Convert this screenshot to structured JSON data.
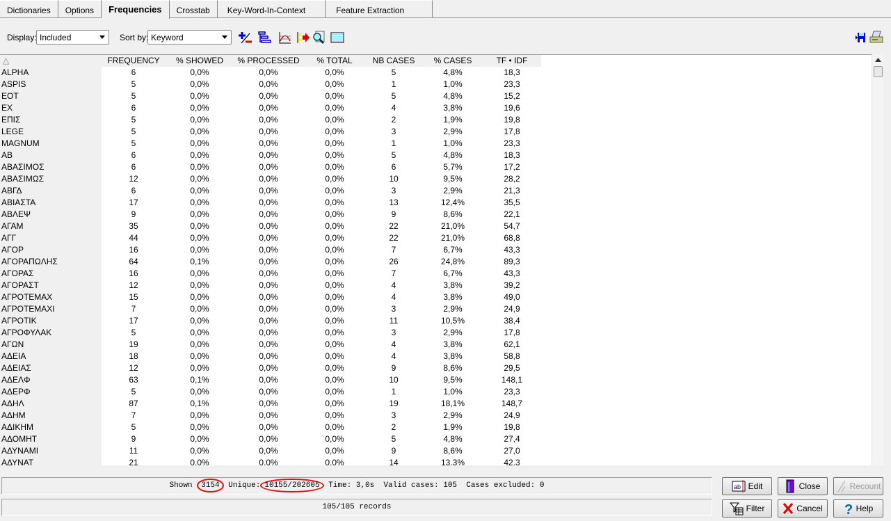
{
  "tabs": [
    {
      "label": "Dictionaries"
    },
    {
      "label": "Options"
    },
    {
      "label": "Frequencies",
      "active": true
    },
    {
      "label": "Crosstab"
    },
    {
      "label": "Key-Word-In-Context"
    },
    {
      "label": "Feature Extraction"
    }
  ],
  "toolbar": {
    "display_label": "Display:",
    "display_value": "Included",
    "sort_label": "Sort by:",
    "sort_value": "Keyword",
    "icons": [
      "add-remove-icon",
      "tree-icon",
      "chart-icon",
      "export-arrow-icon",
      "search-document-icon",
      "list-view-icon"
    ],
    "right_icons": [
      "save-icon",
      "print-icon"
    ]
  },
  "table": {
    "sort_indicator": "△",
    "columns": [
      "FREQUENCY",
      "% SHOWED",
      "% PROCESSED",
      "% TOTAL",
      "NB CASES",
      "% CASES",
      "TF • IDF"
    ],
    "rows": [
      [
        "ALPHA",
        "6",
        "0,0%",
        "0,0%",
        "0,0%",
        "5",
        "4,8%",
        "18,3"
      ],
      [
        "ASPIS",
        "5",
        "0,0%",
        "0,0%",
        "0,0%",
        "1",
        "1,0%",
        "23,3"
      ],
      [
        "EOT",
        "5",
        "0,0%",
        "0,0%",
        "0,0%",
        "5",
        "4,8%",
        "15,2"
      ],
      [
        "EX",
        "6",
        "0,0%",
        "0,0%",
        "0,0%",
        "4",
        "3,8%",
        "19,6"
      ],
      [
        "ΕΠΙΣ",
        "5",
        "0,0%",
        "0,0%",
        "0,0%",
        "2",
        "1,9%",
        "19,8"
      ],
      [
        "LEGE",
        "5",
        "0,0%",
        "0,0%",
        "0,0%",
        "3",
        "2,9%",
        "17,8"
      ],
      [
        "MAGNUM",
        "5",
        "0,0%",
        "0,0%",
        "0,0%",
        "1",
        "1,0%",
        "23,3"
      ],
      [
        "AB",
        "6",
        "0,0%",
        "0,0%",
        "0,0%",
        "5",
        "4,8%",
        "18,3"
      ],
      [
        "ΑΒΑΣΙΜΟΣ",
        "6",
        "0,0%",
        "0,0%",
        "0,0%",
        "6",
        "5,7%",
        "17,2"
      ],
      [
        "ΑΒΑΣΙΜΩΣ",
        "12",
        "0,0%",
        "0,0%",
        "0,0%",
        "10",
        "9,5%",
        "28,2"
      ],
      [
        "ΑΒΓΔ",
        "6",
        "0,0%",
        "0,0%",
        "0,0%",
        "3",
        "2,9%",
        "21,3"
      ],
      [
        "ΑΒΙΑΣΤΑ",
        "17",
        "0,0%",
        "0,0%",
        "0,0%",
        "13",
        "12,4%",
        "35,5"
      ],
      [
        "ΑΒΛΕΨ",
        "9",
        "0,0%",
        "0,0%",
        "0,0%",
        "9",
        "8,6%",
        "22,1"
      ],
      [
        "ΑΓΑΜ",
        "35",
        "0,0%",
        "0,0%",
        "0,0%",
        "22",
        "21,0%",
        "54,7"
      ],
      [
        "ΑΓΓ",
        "44",
        "0,0%",
        "0,0%",
        "0,0%",
        "22",
        "21,0%",
        "68,8"
      ],
      [
        "ΑΓΟΡ",
        "16",
        "0,0%",
        "0,0%",
        "0,0%",
        "7",
        "6,7%",
        "43,3"
      ],
      [
        "ΑΓΟΡΑΠΩΛΗΣ",
        "64",
        "0,1%",
        "0,0%",
        "0,0%",
        "26",
        "24,8%",
        "89,3"
      ],
      [
        "ΑΓΟΡΑΣ",
        "16",
        "0,0%",
        "0,0%",
        "0,0%",
        "7",
        "6,7%",
        "43,3"
      ],
      [
        "ΑΓΟΡΑΣΤ",
        "12",
        "0,0%",
        "0,0%",
        "0,0%",
        "4",
        "3,8%",
        "39,2"
      ],
      [
        "ΑΓΡΟΤΕΜΑΧ",
        "15",
        "0,0%",
        "0,0%",
        "0,0%",
        "4",
        "3,8%",
        "49,0"
      ],
      [
        "ΑΓΡΟΤΕΜΑΧΙ",
        "7",
        "0,0%",
        "0,0%",
        "0,0%",
        "3",
        "2,9%",
        "24,9"
      ],
      [
        "ΑΓΡΟΤΙΚ",
        "17",
        "0,0%",
        "0,0%",
        "0,0%",
        "11",
        "10,5%",
        "38,4"
      ],
      [
        "ΑΓΡΟΦΥΛΑΚ",
        "5",
        "0,0%",
        "0,0%",
        "0,0%",
        "3",
        "2,9%",
        "17,8"
      ],
      [
        "ΑΓΩΝ",
        "19",
        "0,0%",
        "0,0%",
        "0,0%",
        "4",
        "3,8%",
        "62,1"
      ],
      [
        "ΑΔΕΙΑ",
        "18",
        "0,0%",
        "0,0%",
        "0,0%",
        "4",
        "3,8%",
        "58,8"
      ],
      [
        "ΑΔΕΙΑΣ",
        "12",
        "0,0%",
        "0,0%",
        "0,0%",
        "9",
        "8,6%",
        "29,5"
      ],
      [
        "ΑΔΕΛΦ",
        "63",
        "0,1%",
        "0,0%",
        "0,0%",
        "10",
        "9,5%",
        "148,1"
      ],
      [
        "ΑΔΕΡΦ",
        "5",
        "0,0%",
        "0,0%",
        "0,0%",
        "1",
        "1,0%",
        "23,3"
      ],
      [
        "ΑΔΗΛ",
        "87",
        "0,1%",
        "0,0%",
        "0,0%",
        "19",
        "18,1%",
        "148,7"
      ],
      [
        "ΑΔΗΜ",
        "7",
        "0,0%",
        "0,0%",
        "0,0%",
        "3",
        "2,9%",
        "24,9"
      ],
      [
        "ΑΔΙΚΗΜ",
        "5",
        "0,0%",
        "0,0%",
        "0,0%",
        "2",
        "1,9%",
        "19,8"
      ],
      [
        "ΑΔΟΜΗΤ",
        "9",
        "0,0%",
        "0,0%",
        "0,0%",
        "5",
        "4,8%",
        "27,4"
      ],
      [
        "ΑΔΥΝΑΜΙ",
        "11",
        "0,0%",
        "0,0%",
        "0,0%",
        "9",
        "8,6%",
        "27,0"
      ],
      [
        "ΑΔΥΝΑΤ",
        "21",
        "0,0%",
        "0,0%",
        "0,0%",
        "14",
        "13,3%",
        "42,3"
      ]
    ]
  },
  "status": {
    "shown_label": "Shown",
    "shown": "3154",
    "unique_label": "Unique:",
    "unique": "10155/202605",
    "rest": "Time: 3,0s  Valid cases: 105  Cases excluded: 0",
    "records": "105/105 records"
  },
  "buttons": {
    "edit": "Edit",
    "close": "Close",
    "recount": "Recount",
    "filter": "Filter",
    "cancel": "Cancel",
    "help": "Help"
  },
  "colors": {
    "highlight_ring": "#e01010",
    "accent_blue": "#0000c0"
  }
}
